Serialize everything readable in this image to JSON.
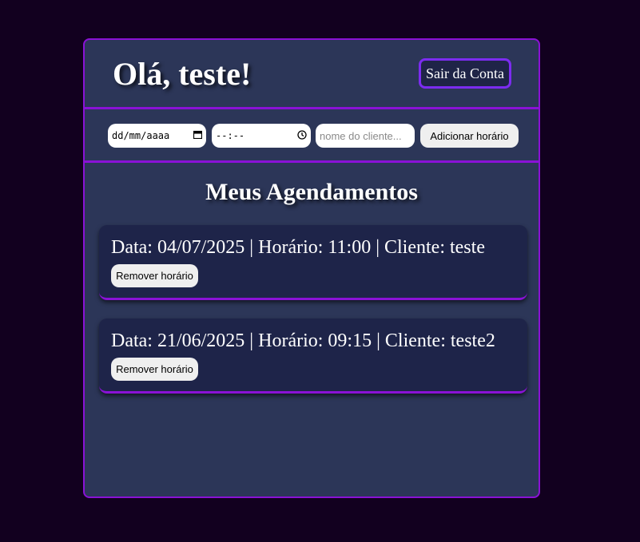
{
  "header": {
    "greeting": "Olá, teste!",
    "logout_label": "Sair da Conta"
  },
  "form": {
    "date_placeholder": "dd/mm/aaaa",
    "time_placeholder": "--:--",
    "client_placeholder": "nome do cliente...",
    "add_label": "Adicionar horário",
    "date_icon": "calendar-icon",
    "time_icon": "clock-icon"
  },
  "main": {
    "title": "Meus Agendamentos",
    "appointments": [
      {
        "text": "Data: 04/07/2025 | Horário: 11:00 | Cliente: teste",
        "remove_label": "Remover horário"
      },
      {
        "text": "Data: 21/06/2025 | Horário: 09:15 | Cliente: teste2",
        "remove_label": "Remover horário"
      }
    ]
  },
  "colors": {
    "background": "#12001f",
    "panel": "#2c3658",
    "accent": "#8a12d6",
    "card": "#1e2449"
  }
}
